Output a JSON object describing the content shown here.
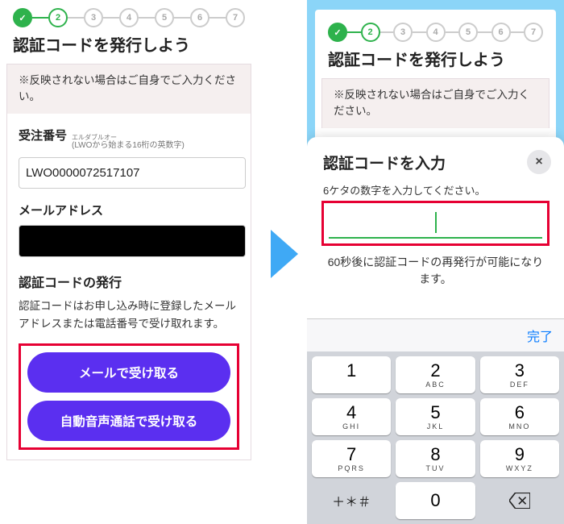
{
  "steps": {
    "total": 7,
    "current": 2
  },
  "title": "認証コードを発行しよう",
  "notice": "※反映されない場合はご自身でご入力ください。",
  "order": {
    "label": "受注番号",
    "ruby": "エルダブルオー",
    "hint": "(LWOから始まる16桁の英数字)",
    "value": "LWO0000072517107"
  },
  "email": {
    "label": "メールアドレス"
  },
  "issue": {
    "title": "認証コードの発行",
    "desc": "認証コードはお申し込み時に登録したメールアドレスまたは電話番号で受け取れます。"
  },
  "buttons": {
    "email": "メールで受け取る",
    "voice": "自動音声通話で受け取る"
  },
  "modal": {
    "title": "認証コードを入力",
    "sub": "6ケタの数字を入力してください。",
    "desc": "60秒後に認証コードの再発行が可能になります。",
    "close": "×"
  },
  "keypad": {
    "done": "完了",
    "keys": [
      {
        "n": "1",
        "l": ""
      },
      {
        "n": "2",
        "l": "ABC"
      },
      {
        "n": "3",
        "l": "DEF"
      },
      {
        "n": "4",
        "l": "GHI"
      },
      {
        "n": "5",
        "l": "JKL"
      },
      {
        "n": "6",
        "l": "MNO"
      },
      {
        "n": "7",
        "l": "PQRS"
      },
      {
        "n": "8",
        "l": "TUV"
      },
      {
        "n": "9",
        "l": "WXYZ"
      }
    ],
    "fn": "＋＊＃",
    "zero": "0"
  }
}
